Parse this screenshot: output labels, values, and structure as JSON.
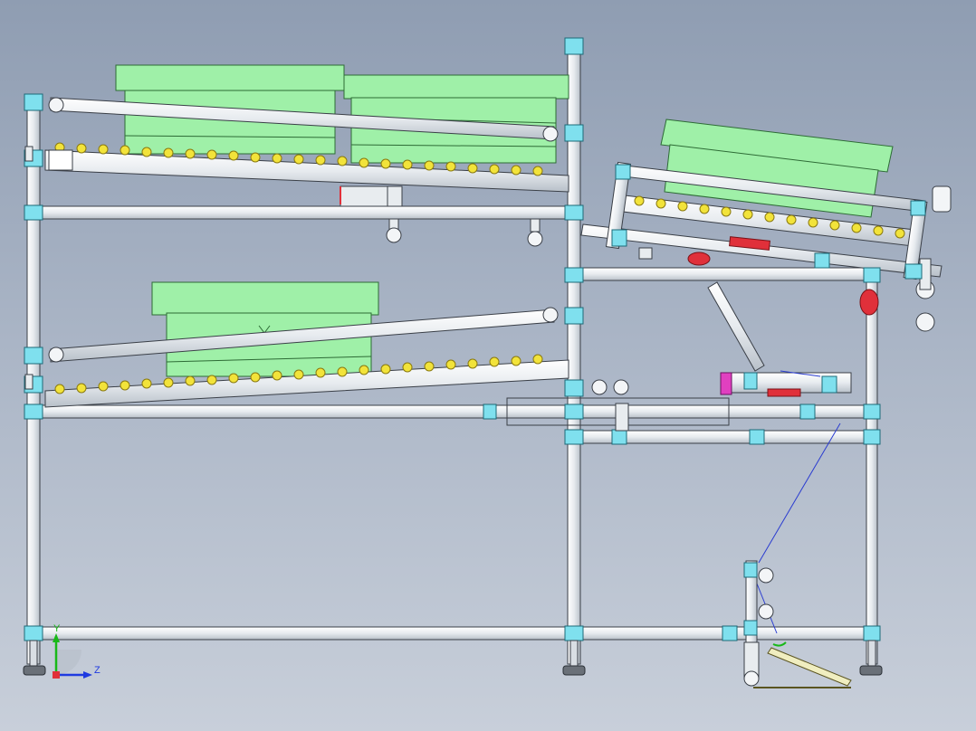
{
  "window": {
    "type": "cad-viewport",
    "view": "side elevation"
  },
  "colors": {
    "background_top": "#8f9db2",
    "background_bottom": "#c8cfda",
    "tube": "#f3f5f7",
    "tube_edge": "#3a3f47",
    "joint": "#7fe0ee",
    "bin": "#9ff0a8",
    "bin_edge": "#2d6b35",
    "roller": "#f2e33a",
    "cylinder_red": "#e0303a",
    "cylinder_magenta": "#e040c0",
    "cable": "#2a3cd0",
    "axis_y": "#18b818",
    "axis_z": "#1f3ae0"
  },
  "axis_triad": {
    "y_label": "Y",
    "z_label": "Z"
  }
}
